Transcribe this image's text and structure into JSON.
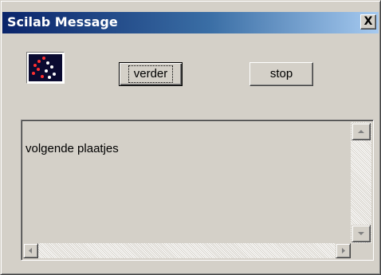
{
  "window": {
    "title": "Scilab Message",
    "close_glyph": "X"
  },
  "icons": {
    "app_icon": "scilab-app-icon",
    "close": "close-icon",
    "scroll_up": "arrow-up-icon",
    "scroll_down": "arrow-down-icon",
    "scroll_left": "arrow-left-icon",
    "scroll_right": "arrow-right-icon"
  },
  "buttons": {
    "verder_label": "verder",
    "stop_label": "stop"
  },
  "message": {
    "text": "volgende plaatjes"
  },
  "colors": {
    "title_gradient_start": "#0a246a",
    "title_gradient_end": "#a6caf0",
    "window_face": "#d4d0c8"
  }
}
